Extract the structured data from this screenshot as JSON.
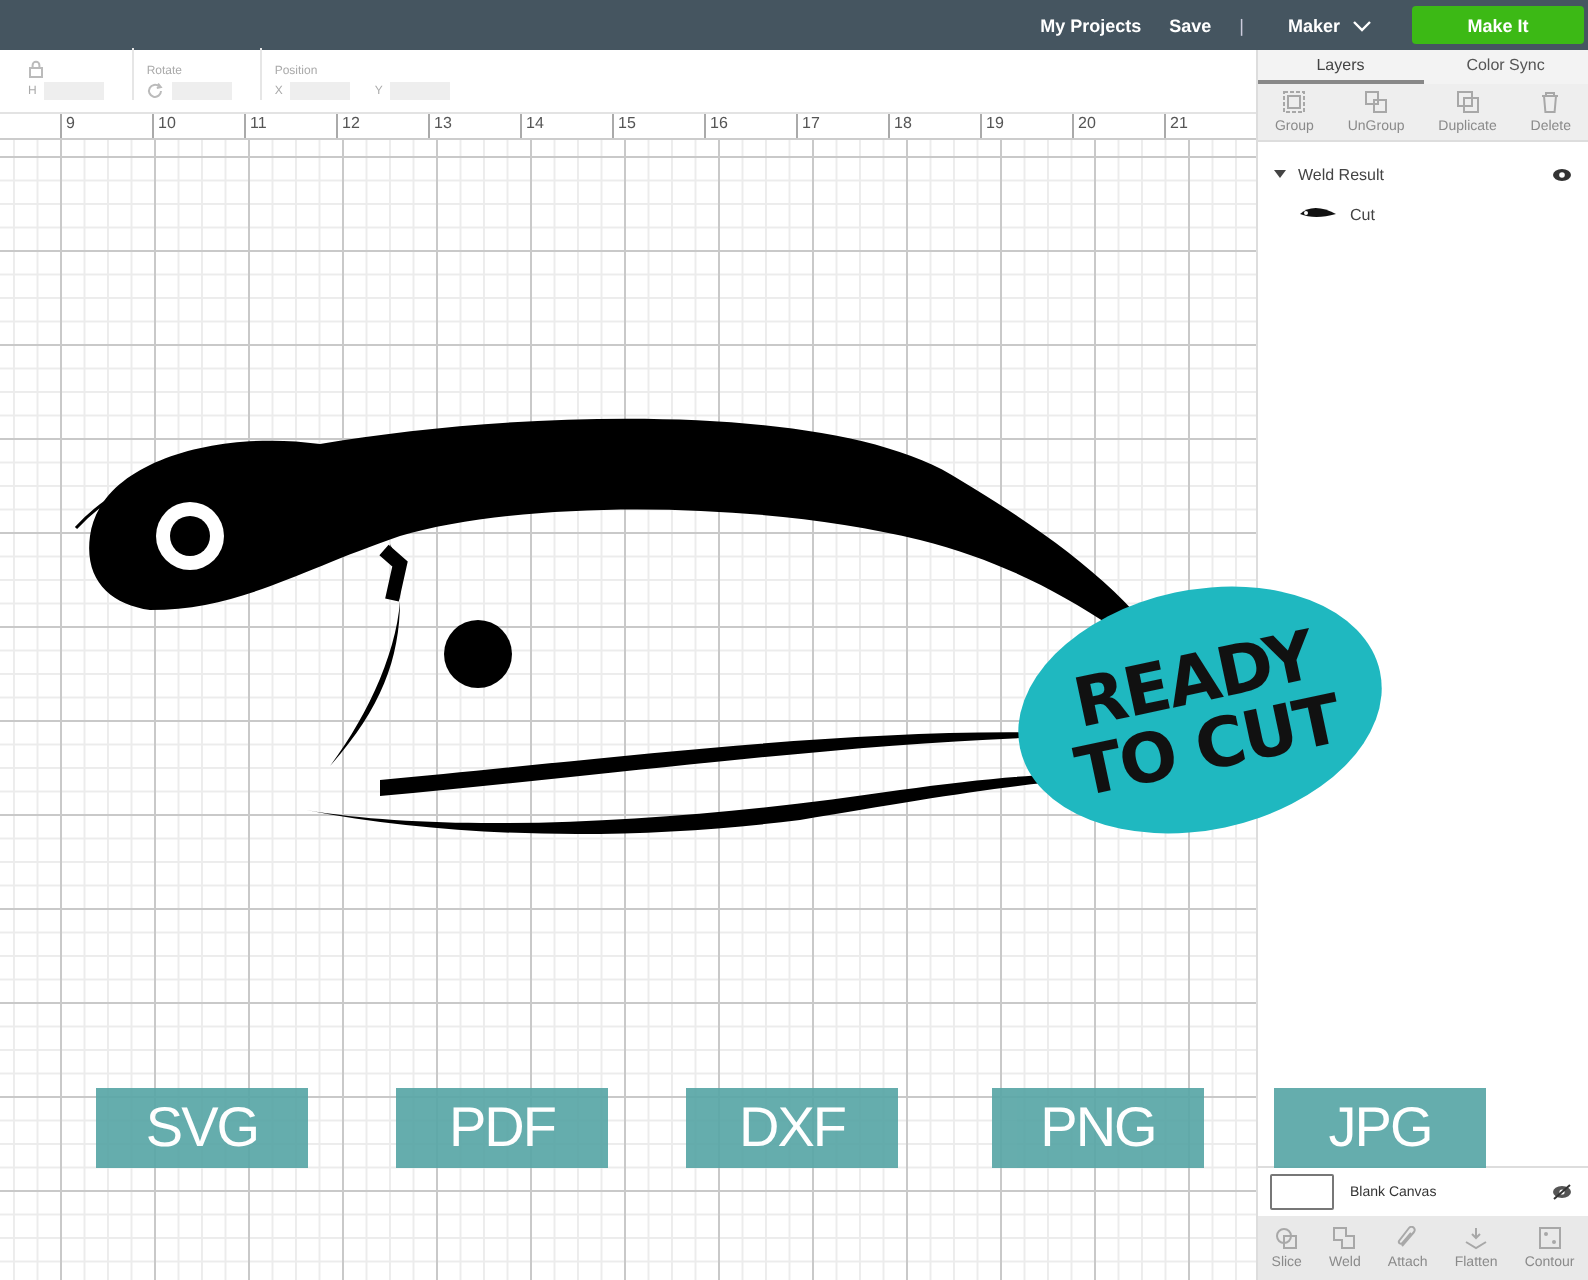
{
  "top_bar": {
    "links": [
      "My Projects",
      "Save"
    ],
    "separator": "|",
    "machine": "Maker",
    "make_button": "Make It"
  },
  "toolbar": {
    "size": {
      "label": "H"
    },
    "rotate": {
      "label": "Rotate"
    },
    "position": {
      "label": "Position",
      "x": "X",
      "y": "Y"
    }
  },
  "ruler": [
    "9",
    "10",
    "11",
    "12",
    "13",
    "14",
    "15",
    "16",
    "17",
    "18",
    "19",
    "20",
    "21"
  ],
  "panel": {
    "tabs": [
      {
        "label": "Layers",
        "selected": true
      },
      {
        "label": "Color Sync",
        "selected": false
      }
    ],
    "actions": [
      {
        "label": "Group",
        "disabled": true
      },
      {
        "label": "UnGroup",
        "disabled": true
      },
      {
        "label": "Duplicate",
        "disabled": true
      },
      {
        "label": "Delete",
        "disabled": true
      }
    ],
    "layers": [
      {
        "name": "Weld Result",
        "expanded": true,
        "visible": true,
        "children": [
          {
            "name": "Cut"
          }
        ]
      }
    ],
    "blank_canvas": {
      "label": "Blank Canvas",
      "visible": false
    },
    "bottom_actions": [
      {
        "label": "Slice",
        "disabled": true
      },
      {
        "label": "Weld",
        "disabled": true
      },
      {
        "label": "Attach",
        "disabled": true
      },
      {
        "label": "Flatten",
        "disabled": true
      },
      {
        "label": "Contour",
        "disabled": true
      }
    ]
  },
  "overlay": {
    "ready_badge": [
      "READY",
      "TO CUT"
    ],
    "formats": [
      "SVG",
      "PDF",
      "DXF",
      "PNG",
      "JPG"
    ]
  }
}
